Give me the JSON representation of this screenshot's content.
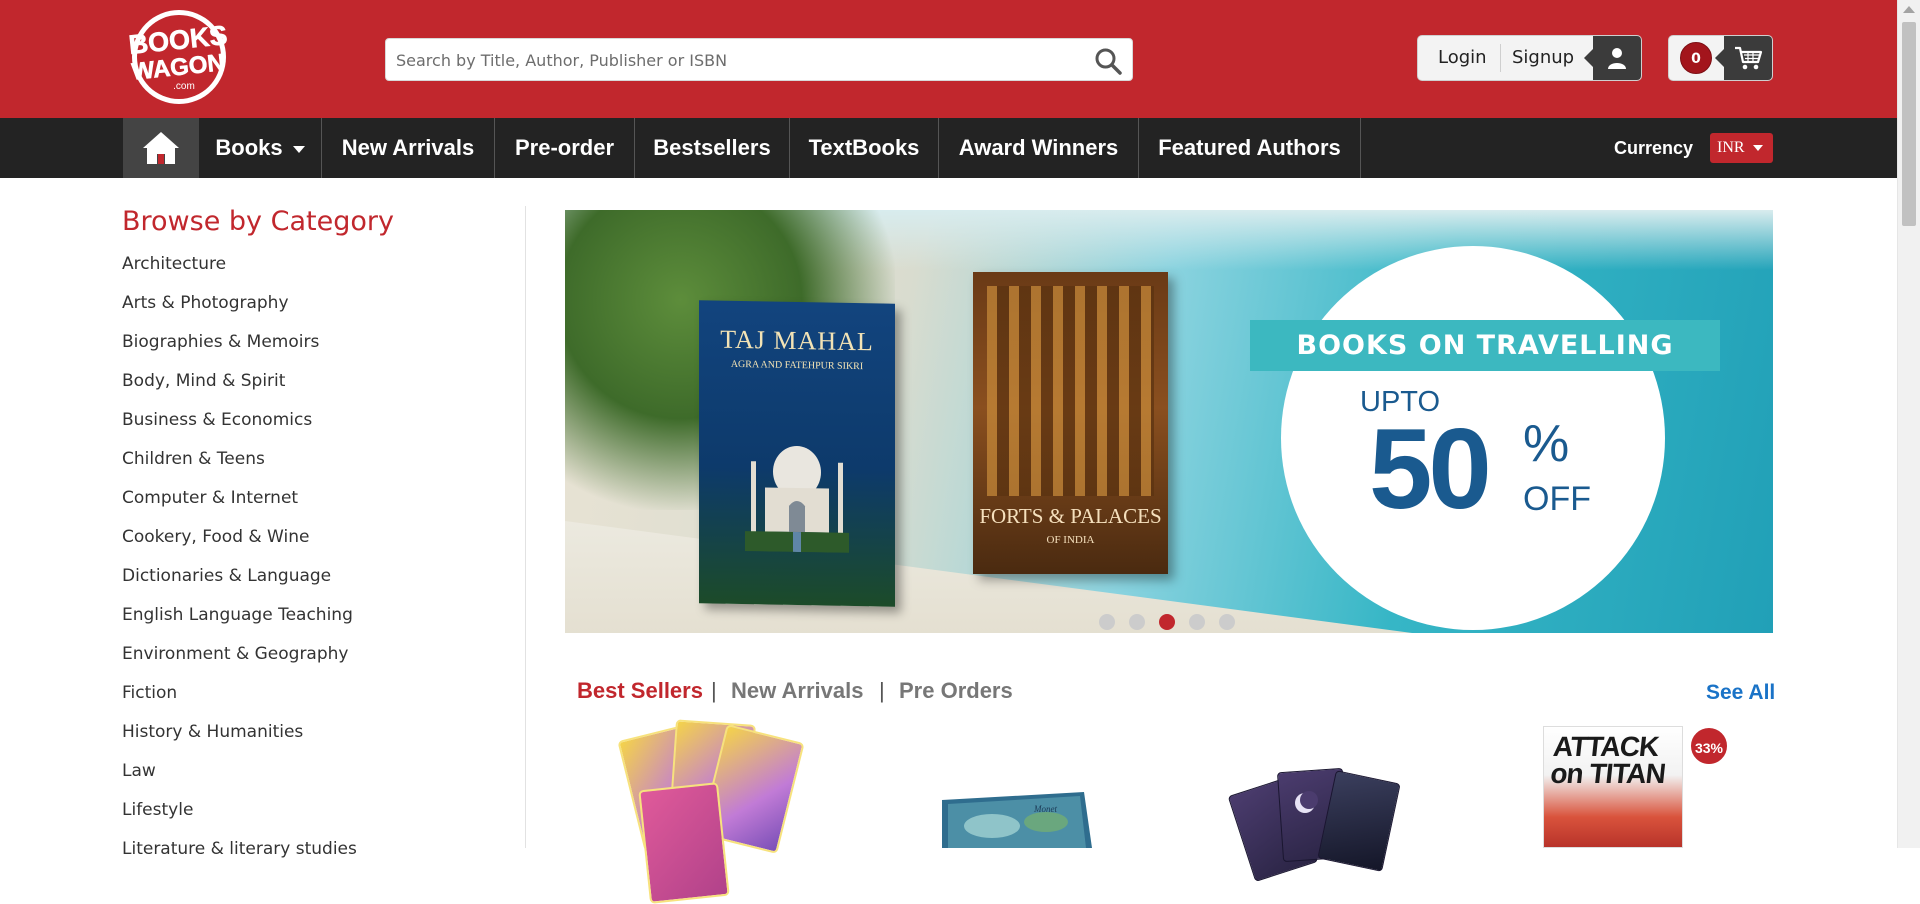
{
  "header": {
    "logo_text": "BOOKS WAGON .com",
    "search_placeholder": "Search by Title, Author, Publisher or ISBN",
    "login_label": "Login",
    "signup_label": "Signup",
    "cart_count": "0",
    "brand_color": "#c1272d"
  },
  "nav": {
    "home_icon": "home-icon",
    "items": [
      {
        "label": "Books"
      },
      {
        "label": "New Arrivals"
      },
      {
        "label": "Pre-order"
      },
      {
        "label": "Bestsellers"
      },
      {
        "label": "TextBooks"
      },
      {
        "label": "Award Winners"
      },
      {
        "label": "Featured Authors"
      }
    ],
    "currency_label": "Currency",
    "currency_value": "INR"
  },
  "sidebar": {
    "title": "Browse by Category",
    "categories": [
      "Architecture",
      "Arts & Photography",
      "Biographies & Memoirs",
      "Body, Mind & Spirit",
      "Business & Economics",
      "Children & Teens",
      "Computer & Internet",
      "Cookery, Food & Wine",
      "Dictionaries & Language",
      "English Language Teaching",
      "Environment & Geography",
      "Fiction",
      "History & Humanities",
      "Law",
      "Lifestyle",
      "Literature & literary studies"
    ]
  },
  "banner": {
    "book1_title": "TAJ MAHAL",
    "book1_subtitle": "AGRA AND FATEHPUR SIKRI",
    "book2_title": "FORTS & PALACES",
    "book2_subtitle": "OF INDIA",
    "promo_heading": "BOOKS ON TRAVELLING",
    "promo_upto": "UPTO",
    "promo_number": "50",
    "promo_percent": "%",
    "promo_off": "OFF",
    "slide_count": 5,
    "active_slide": 3
  },
  "products": {
    "tabs": [
      {
        "label": "Best Sellers",
        "active": true
      },
      {
        "label": "New Arrivals",
        "active": false
      },
      {
        "label": "Pre Orders",
        "active": false
      }
    ],
    "separator": "|",
    "see_all_label": "See All",
    "manga_title_line1": "ATTACK",
    "manga_title_line2": "on TITAN",
    "discount_badge": "33%"
  }
}
